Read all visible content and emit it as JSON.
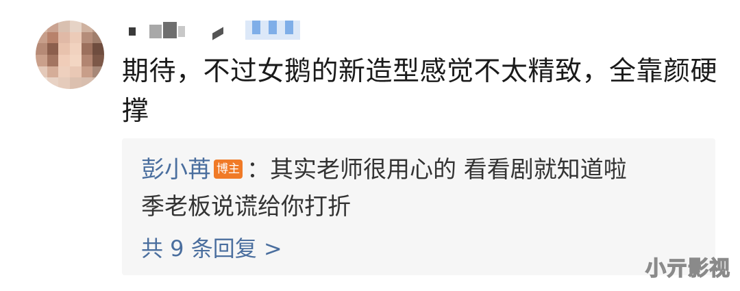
{
  "comment": {
    "text": "期待，不过女鹅的新造型感觉不太精致，全靠颜硬撑"
  },
  "reply": {
    "author": "彭小苒",
    "badge": "博主",
    "text_line1": "：其实老师很用心的 看看剧就知道啦",
    "text_line2": "季老板说谎给你打折",
    "more_label": "共 9 条回复 >"
  },
  "watermark": {
    "text": "小亓影视"
  },
  "colors": {
    "author_link": "#4a6e9e",
    "badge_bg": "#f07a27",
    "reply_bg": "#f6f6f6"
  }
}
